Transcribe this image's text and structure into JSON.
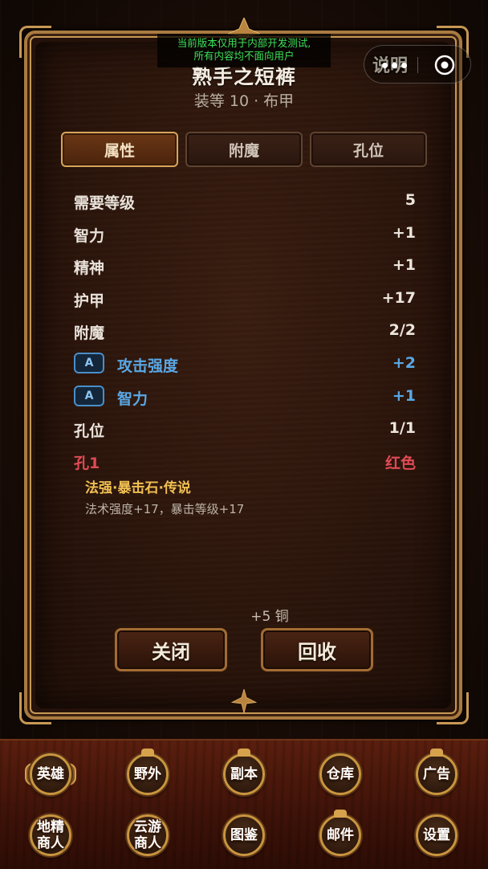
{
  "notice": {
    "line1": "当前版本仅用于内部开发测试,",
    "line2": "所有内容均不面向用户"
  },
  "capsule": {
    "more_icon": "more-dots-icon",
    "close_icon": "target-close-icon"
  },
  "header": {
    "explain_label": "说明",
    "item_name": "熟手之短裤",
    "item_sub": "装等 10 · 布甲"
  },
  "tabs": [
    {
      "label": "属性",
      "active": true
    },
    {
      "label": "附魔",
      "active": false
    },
    {
      "label": "孔位",
      "active": false
    }
  ],
  "stats": [
    {
      "label": "需要等级",
      "value": "5"
    },
    {
      "label": "智力",
      "value": "+1"
    },
    {
      "label": "精神",
      "value": "+1"
    },
    {
      "label": "护甲",
      "value": "+17"
    },
    {
      "label": "附魔",
      "value": "2/2"
    }
  ],
  "enchants": [
    {
      "badge": "A",
      "label": "攻击强度",
      "value": "+2"
    },
    {
      "badge": "A",
      "label": "智力",
      "value": "+1"
    }
  ],
  "sockets": {
    "label": "孔位",
    "value": "1/1",
    "slot_label": "孔1",
    "slot_color": "红色",
    "gem_name": "法强·暴击石·传说",
    "gem_desc": "法术强度+17，暴击等级+17"
  },
  "price": "+5 铜",
  "buttons": {
    "close": "关闭",
    "recycle": "回收"
  },
  "nav": [
    {
      "label1": "英雄",
      "label2": ""
    },
    {
      "label1": "野外",
      "label2": ""
    },
    {
      "label1": "副本",
      "label2": ""
    },
    {
      "label1": "仓库",
      "label2": ""
    },
    {
      "label1": "广告",
      "label2": ""
    },
    {
      "label1": "地精",
      "label2": "商人"
    },
    {
      "label1": "云游",
      "label2": "商人"
    },
    {
      "label1": "图鉴",
      "label2": ""
    },
    {
      "label1": "邮件",
      "label2": ""
    },
    {
      "label1": "设置",
      "label2": ""
    }
  ],
  "colors": {
    "frame_gold": "#c79854",
    "enchant_blue": "#59a8e6",
    "socket_red": "#e04a55",
    "gem_gold": "#f1c052",
    "notice_green": "#3ce05a"
  }
}
